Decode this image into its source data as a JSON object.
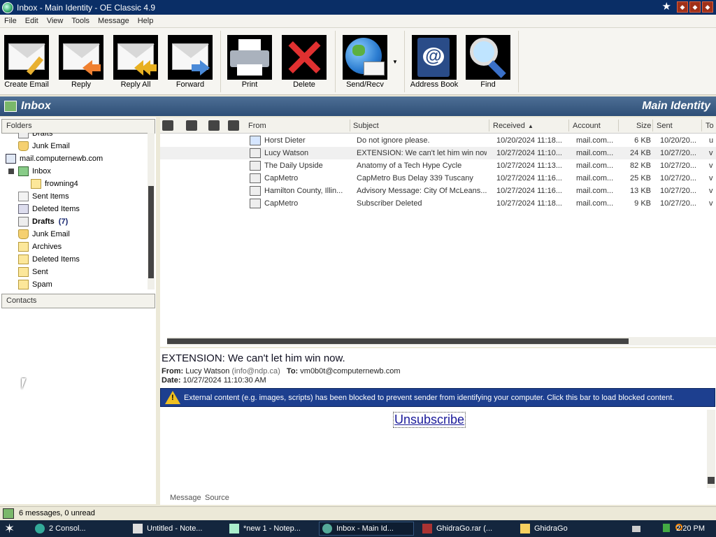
{
  "window": {
    "title": "Inbox - Main Identity - OE Classic 4.9"
  },
  "menu": [
    "File",
    "Edit",
    "View",
    "Tools",
    "Message",
    "Help"
  ],
  "toolbar": {
    "create_email": "Create Email",
    "reply": "Reply",
    "reply_all": "Reply All",
    "forward": "Forward",
    "print": "Print",
    "delete": "Delete",
    "send_recv": "Send/Recv",
    "address_book": "Address Book",
    "find": "Find"
  },
  "header": {
    "title": "Inbox",
    "identity": "Main Identity"
  },
  "folders": {
    "heading": "Folders",
    "items": [
      {
        "label": "Drafts",
        "level": 1,
        "icon": "draft-icon",
        "bold": false,
        "count": ""
      },
      {
        "label": "Junk Email",
        "level": 1,
        "icon": "junk-icon",
        "bold": false,
        "count": ""
      },
      {
        "label": "mail.computernewb.com",
        "level": 0,
        "icon": "server-icon",
        "bold": false,
        "count": ""
      },
      {
        "label": "Inbox",
        "level": 1,
        "icon": "inbox-icon",
        "bold": false,
        "count": ""
      },
      {
        "label": "frowning4",
        "level": 2,
        "icon": "folder-icon",
        "bold": false,
        "count": ""
      },
      {
        "label": "Sent Items",
        "level": 1,
        "icon": "sent-icon",
        "bold": false,
        "count": ""
      },
      {
        "label": "Deleted Items",
        "level": 1,
        "icon": "trash-icon",
        "bold": false,
        "count": ""
      },
      {
        "label": "Drafts",
        "level": 1,
        "icon": "draft-icon",
        "bold": true,
        "count": "(7)"
      },
      {
        "label": "Junk Email",
        "level": 1,
        "icon": "junk-icon",
        "bold": false,
        "count": ""
      },
      {
        "label": "Archives",
        "level": 1,
        "icon": "folder-icon",
        "bold": false,
        "count": ""
      },
      {
        "label": "Deleted Items",
        "level": 1,
        "icon": "folder-icon",
        "bold": false,
        "count": ""
      },
      {
        "label": "Sent",
        "level": 1,
        "icon": "folder-icon",
        "bold": false,
        "count": ""
      },
      {
        "label": "Spam",
        "level": 1,
        "icon": "folder-icon",
        "bold": false,
        "count": ""
      }
    ]
  },
  "contacts": {
    "heading": "Contacts"
  },
  "columns": {
    "from": "From",
    "subject": "Subject",
    "received": "Received",
    "account": "Account",
    "size": "Size",
    "sent": "Sent",
    "to": "To"
  },
  "messages": [
    {
      "from": "Horst Dieter",
      "subject": "Do not ignore please.",
      "received": "10/20/2024 11:18...",
      "account": "mail.com...",
      "size": "6 KB",
      "sent": "10/20/20...",
      "to": "u"
    },
    {
      "from": "Lucy Watson",
      "subject": "EXTENSION: We can't let him win now.",
      "received": "10/27/2024 11:10...",
      "account": "mail.com...",
      "size": "24 KB",
      "sent": "10/27/20...",
      "to": "v"
    },
    {
      "from": "The Daily Upside",
      "subject": "Anatomy of a Tech Hype Cycle",
      "received": "10/27/2024 11:13...",
      "account": "mail.com...",
      "size": "82 KB",
      "sent": "10/27/20...",
      "to": "v"
    },
    {
      "from": "CapMetro",
      "subject": "CapMetro Bus Delay 339 Tuscany",
      "received": "10/27/2024 11:16...",
      "account": "mail.com...",
      "size": "25 KB",
      "sent": "10/27/20...",
      "to": "v"
    },
    {
      "from": "Hamilton County, Illin...",
      "subject": "Advisory Message: City Of McLeans...",
      "received": "10/27/2024 11:16...",
      "account": "mail.com...",
      "size": "13 KB",
      "sent": "10/27/20...",
      "to": "v"
    },
    {
      "from": "CapMetro",
      "subject": "Subscriber Deleted",
      "received": "10/27/2024 11:18...",
      "account": "mail.com...",
      "size": "9 KB",
      "sent": "10/27/20...",
      "to": "v"
    }
  ],
  "preview": {
    "subject": "EXTENSION: We can't let him win now.",
    "from_label": "From:",
    "from_value": "Lucy Watson",
    "from_email": "(info@ndp.ca)",
    "to_label": "To:",
    "to_value": "vm0b0t@computernewb.com",
    "date_label": "Date:",
    "date_value": "10/27/2024 11:10:30 AM",
    "warning": "External content (e.g. images, scripts) has been blocked to prevent sender from identifying your computer. Click this bar to load blocked content.",
    "unsubscribe": "Unsubscribe",
    "tab_message": "Message",
    "tab_source": "Source"
  },
  "status": {
    "text": "6 messages, 0 unread"
  },
  "taskbar": {
    "tasks": [
      "2 Consol...",
      "Untitled - Note...",
      "*new 1 - Notep...",
      "Inbox - Main Id...",
      "GhidraGo.rar (...",
      "GhidraGo"
    ],
    "clock": "2:20 PM"
  }
}
